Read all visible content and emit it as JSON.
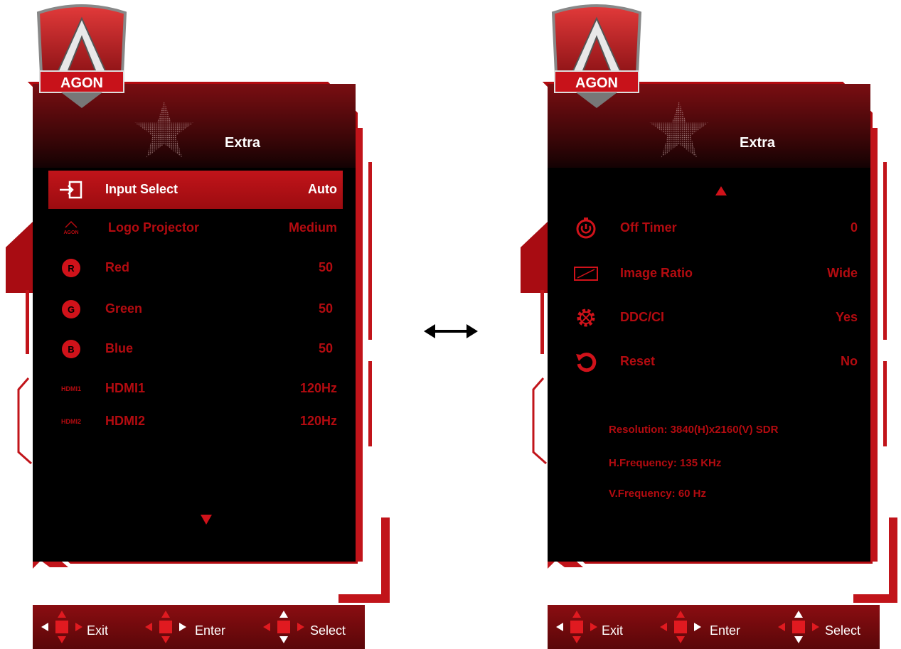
{
  "left_panel": {
    "logo_text": "AGON",
    "title": "Extra",
    "items": [
      {
        "label": "Input Select",
        "value": "Auto",
        "icon": "input-select-icon",
        "selected": true
      },
      {
        "label": "Logo Projector",
        "value": "Medium",
        "icon": "agon-logo-icon",
        "icon_text": "AGON"
      },
      {
        "label": "Red",
        "value": "50",
        "icon": "red-circle-icon",
        "icon_text": "R"
      },
      {
        "label": "Green",
        "value": "50",
        "icon": "green-circle-icon",
        "icon_text": "G"
      },
      {
        "label": "Blue",
        "value": "50",
        "icon": "blue-circle-icon",
        "icon_text": "B"
      },
      {
        "label": "HDMI1",
        "value": "120Hz",
        "icon": "hdmi1-icon",
        "icon_text": "HDMI1"
      },
      {
        "label": "HDMI2",
        "value": "120Hz",
        "icon": "hdmi2-icon",
        "icon_text": "HDMI2"
      }
    ]
  },
  "right_panel": {
    "logo_text": "AGON",
    "title": "Extra",
    "items": [
      {
        "label": "Off Timer",
        "value": "0",
        "icon": "timer-icon"
      },
      {
        "label": "Image Ratio",
        "value": "Wide",
        "icon": "aspect-ratio-icon"
      },
      {
        "label": "DDC/CI",
        "value": "Yes",
        "icon": "ddc-gear-icon"
      },
      {
        "label": "Reset",
        "value": "No",
        "icon": "reset-icon"
      }
    ],
    "info": {
      "resolution": "Resolution: 3840(H)x2160(V) SDR",
      "h_frequency": "H.Frequency: 135 KHz",
      "v_frequency": "V.Frequency: 60 Hz"
    }
  },
  "nav": {
    "exit": "Exit",
    "enter": "Enter",
    "select": "Select"
  },
  "colors": {
    "accent": "#d0121a",
    "text_red": "#b30b10",
    "panel_bg": "#000000",
    "header_dark": "#3b0608"
  }
}
